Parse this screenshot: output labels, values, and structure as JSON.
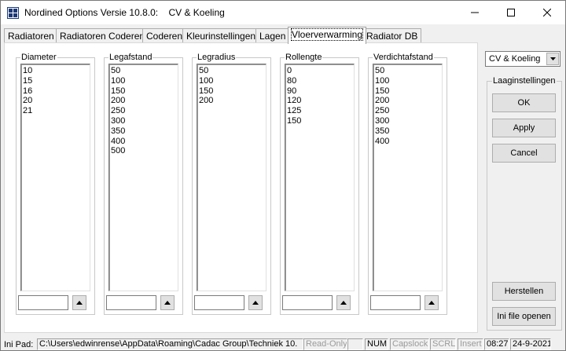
{
  "window": {
    "title": "Nordined Options Versie 10.8.0:    CV & Koeling"
  },
  "tabs": [
    {
      "label": "Radiatoren"
    },
    {
      "label": "Radiatoren Coderen"
    },
    {
      "label": "Coderen"
    },
    {
      "label": "Kleurinstellingen"
    },
    {
      "label": "Lagen"
    },
    {
      "label": "Vloerverwarming",
      "active": true
    },
    {
      "label": "Radiator DB"
    }
  ],
  "groups": [
    {
      "label": "Diameter",
      "items": [
        "10",
        "15",
        "16",
        "20",
        "21"
      ],
      "entry": ""
    },
    {
      "label": "Legafstand",
      "items": [
        "50",
        "100",
        "150",
        "200",
        "250",
        "300",
        "350",
        "400",
        "500"
      ],
      "entry": ""
    },
    {
      "label": "Legradius",
      "items": [
        "50",
        "100",
        "150",
        "200"
      ],
      "entry": ""
    },
    {
      "label": "Rollengte",
      "items": [
        "0",
        "80",
        "90",
        "120",
        "125",
        "150"
      ],
      "entry": ""
    },
    {
      "label": "Verdichtafstand",
      "items": [
        "50",
        "100",
        "150",
        "200",
        "250",
        "300",
        "350",
        "400"
      ],
      "entry": ""
    }
  ],
  "right_panel": {
    "combo_value": "CV & Koeling",
    "group_label": "Laaginstellingen",
    "ok_label": "OK",
    "apply_label": "Apply",
    "cancel_label": "Cancel",
    "herstellen_label": "Herstellen",
    "ini_open_label": "Ini file openen"
  },
  "status": {
    "ini_label": "Ini Pad:",
    "ini_path": "C:\\Users\\edwinrense\\AppData\\Roaming\\Cadac Group\\Techniek 10.",
    "readonly": "Read-Only",
    "num": "NUM",
    "capslock": "Capslock",
    "scrl": "SCRL",
    "insert": "Insert",
    "time": "08:27",
    "date": "24-9-2021"
  },
  "colors": {
    "accent_icon": "#1a3a7a",
    "disabled_text": "#9a9a9a"
  },
  "icons": {
    "app": "app-grid-icon",
    "minimize": "minimize-icon",
    "maximize": "maximize-icon",
    "close": "close-icon",
    "spin_up": "triangle-up-icon",
    "combo": "chevron-down-icon"
  }
}
